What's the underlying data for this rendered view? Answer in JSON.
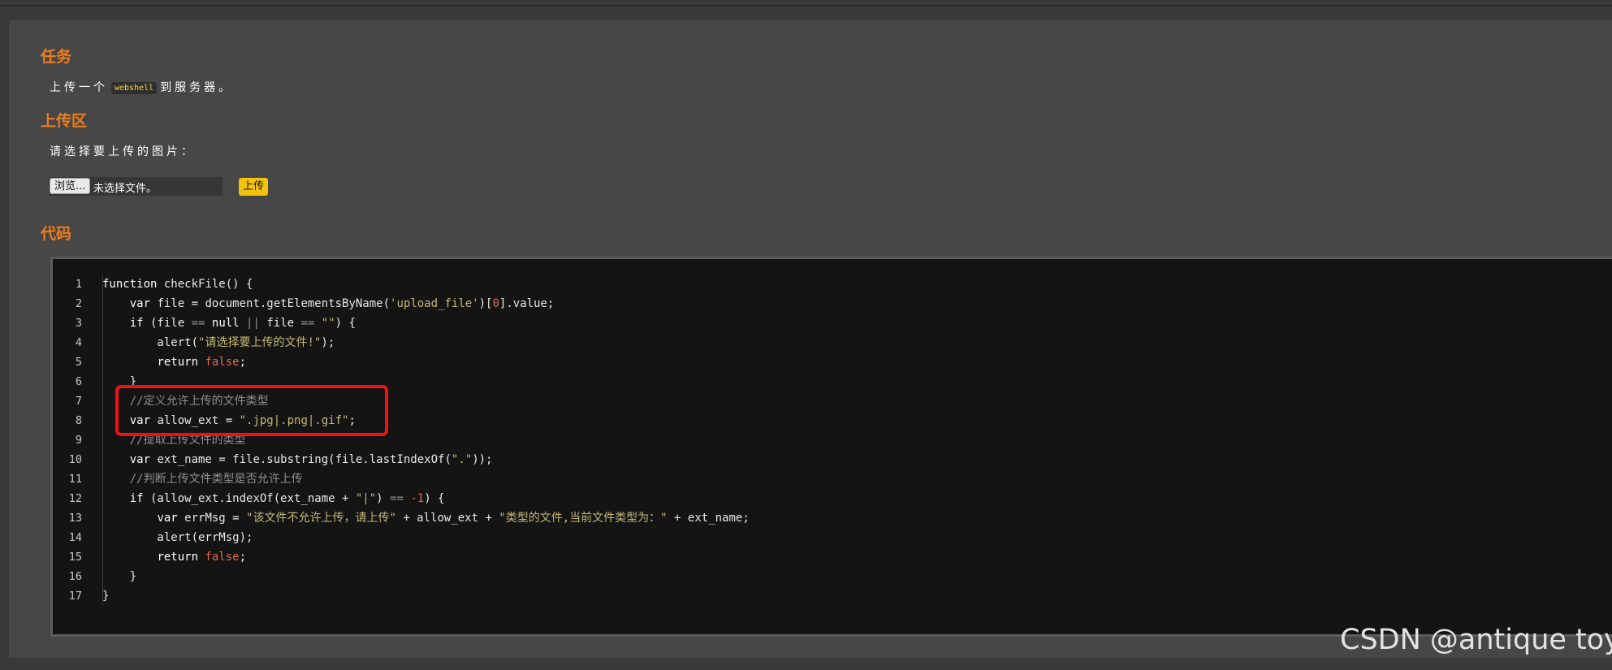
{
  "task": {
    "heading": "任务",
    "text_before": "上传一个",
    "tag": "webshell",
    "text_after": "到服务器。"
  },
  "upload": {
    "heading": "上传区",
    "prompt": "请选择要上传的图片：",
    "browse_label": "浏览...",
    "file_status": "未选择文件。",
    "submit_label": "上传"
  },
  "code": {
    "heading": "代码",
    "lines": [
      "1",
      "2",
      "3",
      "4",
      "5",
      "6",
      "7",
      "8",
      "9",
      "10",
      "11",
      "12",
      "13",
      "14",
      "15",
      "16",
      "17"
    ],
    "source": [
      "function checkFile() {",
      "    var file = document.getElementsByName('upload_file')[0].value;",
      "    if (file == null || file == \"\") {",
      "        alert(\"请选择要上传的文件!\");",
      "        return false;",
      "    }",
      "    //定义允许上传的文件类型",
      "    var allow_ext = \".jpg|.png|.gif\";",
      "    //提取上传文件的类型",
      "    var ext_name = file.substring(file.lastIndexOf(\".\"));",
      "    //判断上传文件类型是否允许上传",
      "    if (allow_ext.indexOf(ext_name + \"|\") == -1) {",
      "        var errMsg = \"该文件不允许上传，请上传\" + allow_ext + \"类型的文件,当前文件类型为：\" + ext_name;",
      "        alert(errMsg);",
      "        return false;",
      "    }",
      "}"
    ]
  },
  "watermark": "CSDN @antique toy",
  "colors": {
    "heading": "#f07d1a",
    "highlight_box": "#f01010",
    "upload_button": "#f4c20d",
    "string": "#c6b974",
    "number": "#e06a4a"
  }
}
